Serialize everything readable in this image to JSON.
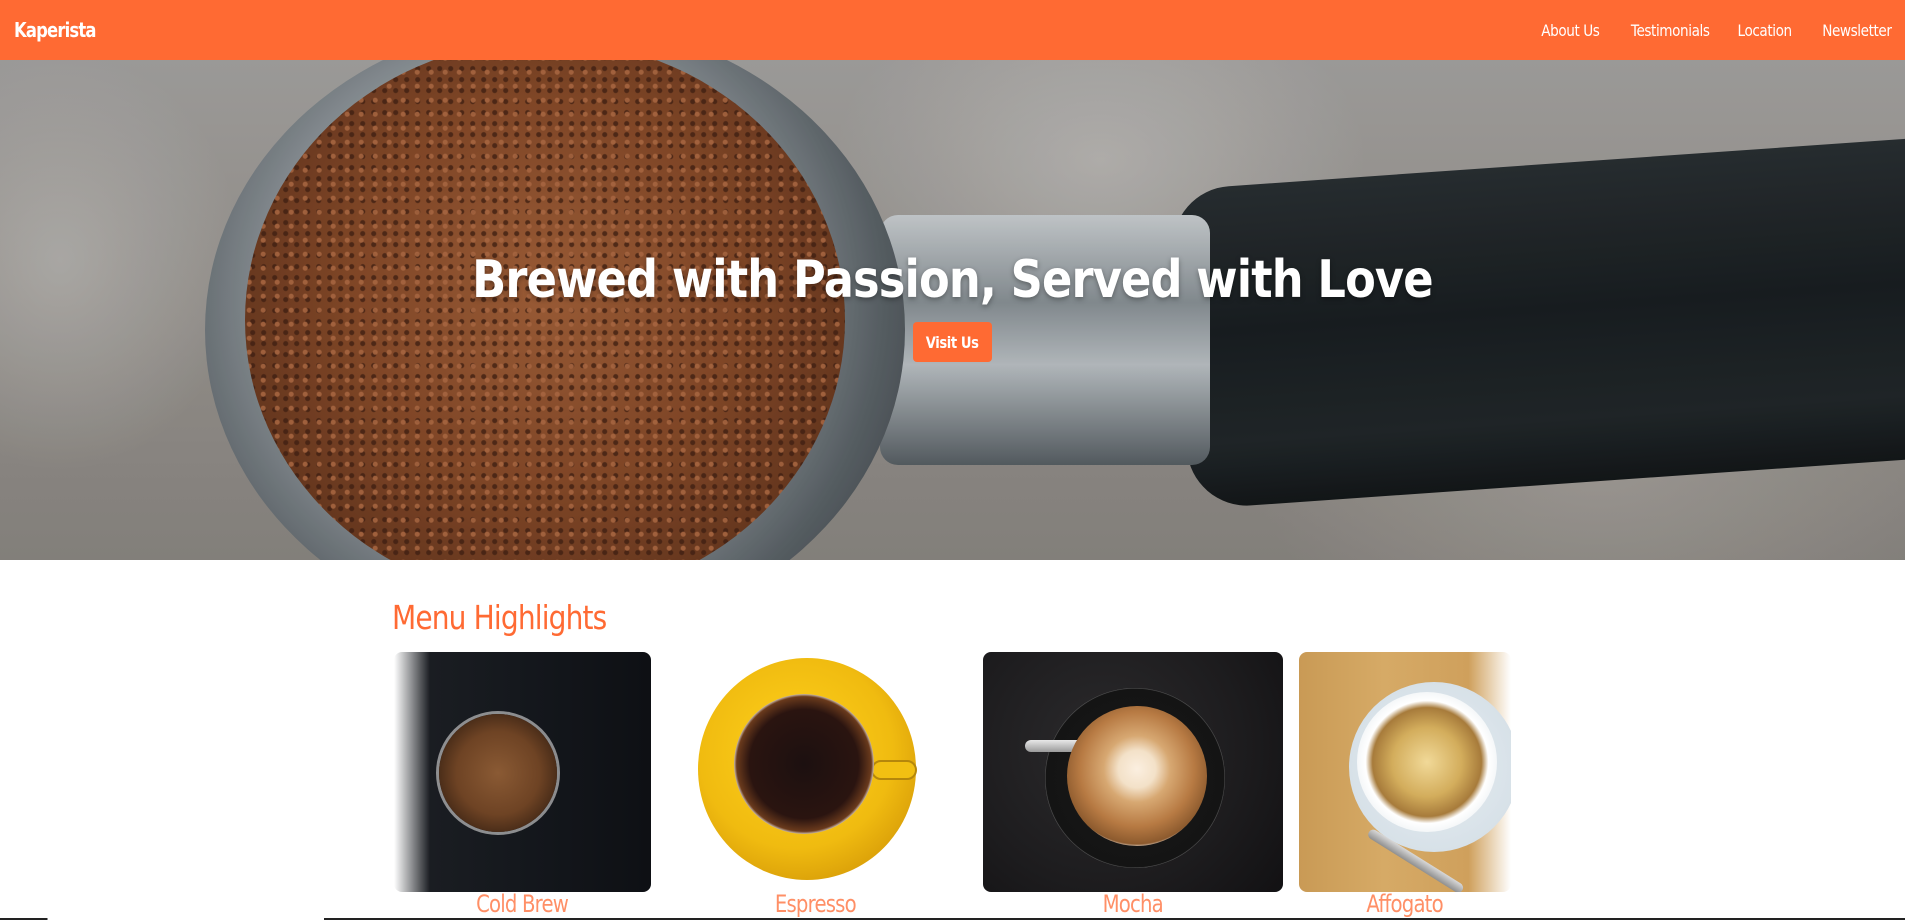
{
  "navbar": {
    "brand": "Kaperista",
    "links": [
      {
        "label": "About Us"
      },
      {
        "label": "Testimonials"
      },
      {
        "label": "Location"
      },
      {
        "label": "Newsletter"
      }
    ]
  },
  "hero": {
    "title": "Brewed with Passion, Served with Love",
    "button_label": "Visit Us"
  },
  "menu": {
    "title": "Menu Highlights",
    "items": [
      {
        "name": "Cold Brew",
        "image": "cold-brew-image"
      },
      {
        "name": "Espresso",
        "image": "espresso-image"
      },
      {
        "name": "Mocha",
        "image": "mocha-image"
      },
      {
        "name": "Affogato",
        "image": "affogato-image"
      }
    ]
  },
  "colors": {
    "accent": "#ff6a33",
    "white": "#ffffff"
  }
}
